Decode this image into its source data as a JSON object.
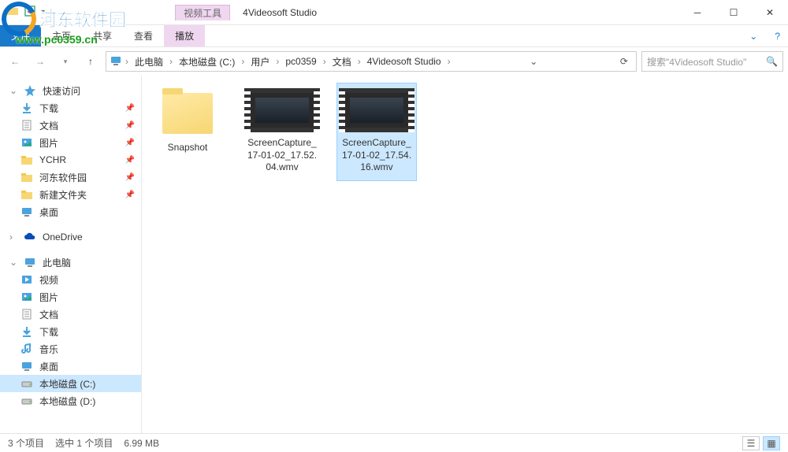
{
  "window": {
    "context_tab": "视频工具",
    "title": "4Videosoft Studio"
  },
  "ribbon": {
    "file": "文件",
    "home": "主页",
    "share": "共享",
    "view": "查看",
    "play": "播放"
  },
  "breadcrumb": {
    "items": [
      "此电脑",
      "本地磁盘 (C:)",
      "用户",
      "pc0359",
      "文档",
      "4Videosoft Studio"
    ]
  },
  "search": {
    "placeholder": "搜索\"4Videosoft Studio\""
  },
  "sidebar": {
    "quick_access": "快速访问",
    "quick_items": [
      {
        "label": "下载",
        "icon": "down",
        "pinned": true
      },
      {
        "label": "文档",
        "icon": "doc",
        "pinned": true
      },
      {
        "label": "图片",
        "icon": "img",
        "pinned": true
      },
      {
        "label": "YCHR",
        "icon": "folder",
        "pinned": true
      },
      {
        "label": "河东软件园",
        "icon": "folder",
        "pinned": true
      },
      {
        "label": "新建文件夹",
        "icon": "folder",
        "pinned": true
      },
      {
        "label": "桌面",
        "icon": "monitor",
        "pinned": false
      }
    ],
    "onedrive": "OneDrive",
    "this_pc": "此电脑",
    "pc_items": [
      {
        "label": "视频",
        "icon": "video"
      },
      {
        "label": "图片",
        "icon": "img"
      },
      {
        "label": "文档",
        "icon": "doc"
      },
      {
        "label": "下载",
        "icon": "down"
      },
      {
        "label": "音乐",
        "icon": "music"
      },
      {
        "label": "桌面",
        "icon": "monitor"
      },
      {
        "label": "本地磁盘 (C:)",
        "icon": "drive",
        "selected": true
      },
      {
        "label": "本地磁盘 (D:)",
        "icon": "drive"
      }
    ]
  },
  "files": [
    {
      "name": "Snapshot",
      "type": "folder",
      "selected": false
    },
    {
      "name": "ScreenCapture_17-01-02_17.52.04.wmv",
      "type": "video",
      "selected": false
    },
    {
      "name": "ScreenCapture_17-01-02_17.54.16.wmv",
      "type": "video",
      "selected": true
    }
  ],
  "status": {
    "count": "3 个项目",
    "selection": "选中 1 个项目",
    "size": "6.99 MB"
  },
  "watermark": {
    "name": "河东软件园",
    "url": "www.pc0359.cn"
  }
}
